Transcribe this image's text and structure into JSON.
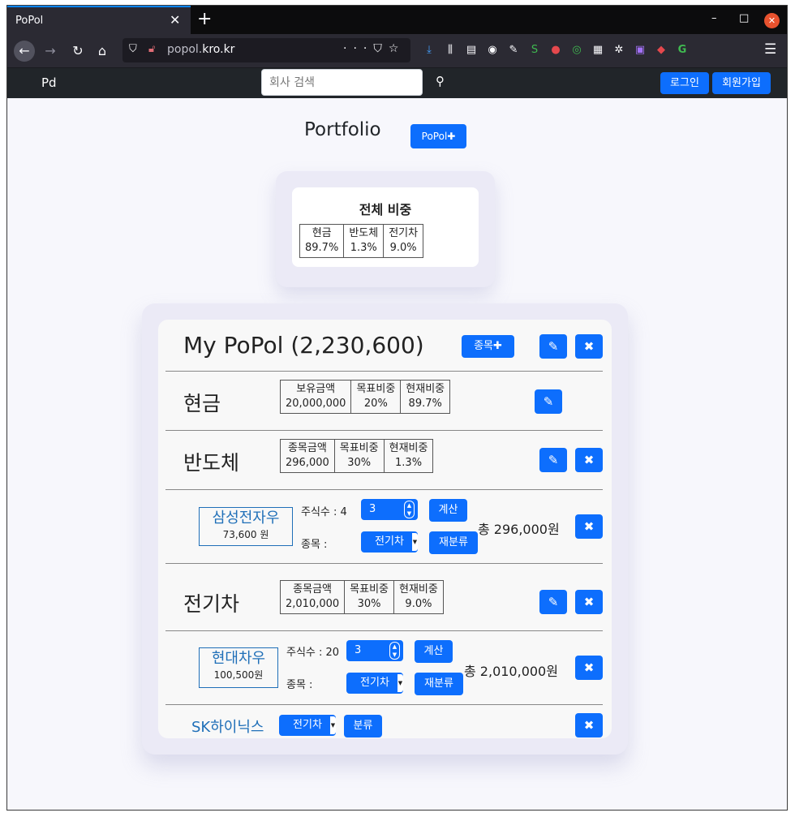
{
  "browser": {
    "tab_title": "PoPol",
    "url_host": "popol.",
    "url_domain": "kro.kr"
  },
  "site": {
    "brand": "Pd",
    "search_placeholder": "회사 검색",
    "login": "로그인",
    "signup": "회원가입"
  },
  "portfolio": {
    "title": "Portfolio",
    "add_button": "PoPol✚"
  },
  "overall": {
    "title": "전체 비중",
    "items": [
      {
        "name": "현금",
        "pct": "89.7%"
      },
      {
        "name": "반도체",
        "pct": "1.3%"
      },
      {
        "name": "전기차",
        "pct": "9.0%"
      }
    ]
  },
  "mypopol": {
    "title": "My PoPol (2,230,600)",
    "add_stock": "종목✚",
    "cash": {
      "name": "현금",
      "headers": [
        "보유금액",
        "목표비중",
        "현재비중"
      ],
      "values": [
        "20,000,000",
        "20%",
        "89.7%"
      ]
    },
    "groups": [
      {
        "name": "반도체",
        "headers": [
          "종목금액",
          "목표비중",
          "현재비중"
        ],
        "values": [
          "296,000",
          "30%",
          "1.3%"
        ],
        "stock": {
          "name": "삼성전자우",
          "price": "73,600 원",
          "shares_label": "주식수 : 4",
          "qty": "3",
          "calc": "계산",
          "cat_label": "종목 :",
          "category": "전기차",
          "reclass": "재분류",
          "total": "총 296,000원"
        }
      },
      {
        "name": "전기차",
        "headers": [
          "종목금액",
          "목표비중",
          "현재비중"
        ],
        "values": [
          "2,010,000",
          "30%",
          "9.0%"
        ],
        "stock": {
          "name": "현대차우",
          "price": "100,500원",
          "shares_label": "주식수 : 20",
          "qty": "3",
          "calc": "계산",
          "cat_label": "종목 :",
          "category": "전기차",
          "reclass": "재분류",
          "total": "총 2,010,000원"
        }
      }
    ],
    "unclassified": {
      "name": "SK하이닉스",
      "category": "전기차",
      "classify": "분류"
    }
  },
  "colors": {
    "primary": "#0d6efd",
    "stock_text": "#1f6fb8",
    "navbar": "#212529"
  }
}
